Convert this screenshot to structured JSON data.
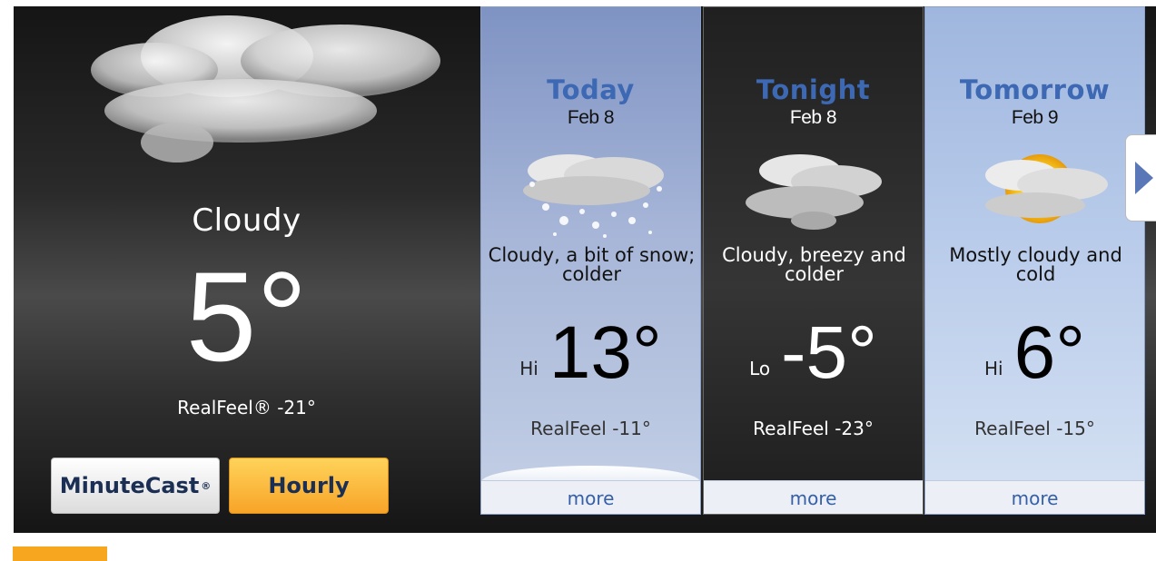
{
  "current": {
    "phrase": "Cloudy",
    "temp": "5°",
    "realfeel": "RealFeel® -21°",
    "icon": "cloudy-icon"
  },
  "buttons": {
    "minutecast": "MinuteCast",
    "minutecast_mark": "®",
    "hourly": "Hourly"
  },
  "forecast": [
    {
      "title": "Today",
      "date": "Feb 8",
      "icon": "cloudy-snow-icon",
      "phrase": "Cloudy, a bit of snow; colder",
      "hilo": "Hi",
      "temp": "13°",
      "realfeel": "RealFeel -11°",
      "more": "more"
    },
    {
      "title": "Tonight",
      "date": "Feb 8",
      "icon": "cloudy-night-icon",
      "phrase": "Cloudy, breezy and colder",
      "hilo": "Lo",
      "temp": "-5°",
      "realfeel": "RealFeel -23°",
      "more": "more"
    },
    {
      "title": "Tomorrow",
      "date": "Feb 9",
      "icon": "mostly-cloudy-sun-icon",
      "phrase": "Mostly cloudy and cold",
      "hilo": "Hi",
      "temp": "6°",
      "realfeel": "RealFeel -15°",
      "more": "more"
    }
  ],
  "colors": {
    "title_blue": "#3d68b3",
    "hourly_orange": "#f7a428",
    "minutecast_navy": "#1b2f55",
    "accent_orange": "#f7a61f"
  }
}
